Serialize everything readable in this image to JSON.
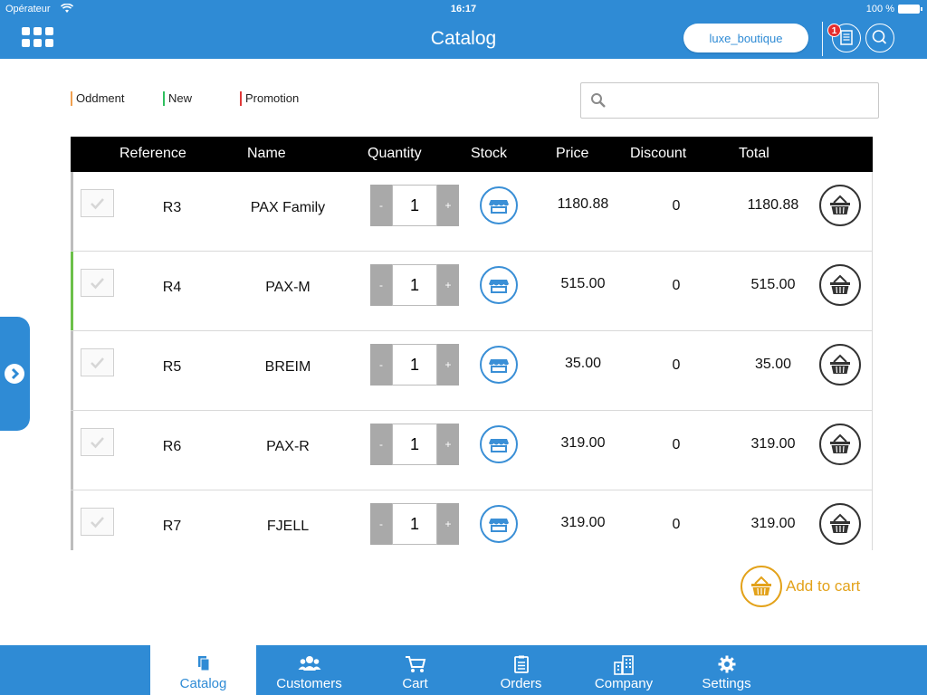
{
  "statusbar": {
    "carrier": "Opérateur",
    "time": "16:17",
    "battery": "100 %"
  },
  "header": {
    "title": "Catalog",
    "shop": "luxe_boutique",
    "badge_count": "1"
  },
  "legend": [
    {
      "label": "Oddment",
      "color": "#f0a050"
    },
    {
      "label": "New",
      "color": "#2fbf5f"
    },
    {
      "label": "Promotion",
      "color": "#e03a3a"
    }
  ],
  "search": {
    "placeholder": "",
    "value": ""
  },
  "table": {
    "columns": {
      "reference": "Reference",
      "name": "Name",
      "quantity": "Quantity",
      "stock": "Stock",
      "price": "Price",
      "discount": "Discount",
      "total": "Total"
    },
    "rows": [
      {
        "ref": "R3",
        "name": "PAX Family",
        "qty": "1",
        "price": "1180.88",
        "discount": "0",
        "total": "1180.88",
        "minus": "-",
        "plus": "+",
        "marker": "gray"
      },
      {
        "ref": "R4",
        "name": "PAX-M",
        "qty": "1",
        "price": "515.00",
        "discount": "0",
        "total": "515.00",
        "minus": "-",
        "plus": "+",
        "marker": "green"
      },
      {
        "ref": "R5",
        "name": "BREIM",
        "qty": "1",
        "price": "35.00",
        "discount": "0",
        "total": "35.00",
        "minus": "-",
        "plus": "+",
        "marker": "gray"
      },
      {
        "ref": "R6",
        "name": "PAX-R",
        "qty": "1",
        "price": "319.00",
        "discount": "0",
        "total": "319.00",
        "minus": "-",
        "plus": "+",
        "marker": "gray"
      },
      {
        "ref": "R7",
        "name": "FJELL",
        "qty": "1",
        "price": "319.00",
        "discount": "0",
        "total": "319.00",
        "minus": "-",
        "plus": "+",
        "marker": "gray"
      }
    ]
  },
  "actions": {
    "add_to_cart": "Add to cart"
  },
  "tabs": [
    {
      "label": "Catalog",
      "icon": "catalog-icon",
      "active": true
    },
    {
      "label": "Customers",
      "icon": "customers-icon",
      "active": false
    },
    {
      "label": "Cart",
      "icon": "cart-icon",
      "active": false
    },
    {
      "label": "Orders",
      "icon": "orders-icon",
      "active": false
    },
    {
      "label": "Company",
      "icon": "company-icon",
      "active": false
    },
    {
      "label": "Settings",
      "icon": "gear-icon",
      "active": false
    }
  ],
  "colors": {
    "primary": "#2f8bd5",
    "accent": "#e3a21a",
    "marker_gray": "#bdbdbd",
    "marker_green": "#6cc04a"
  }
}
